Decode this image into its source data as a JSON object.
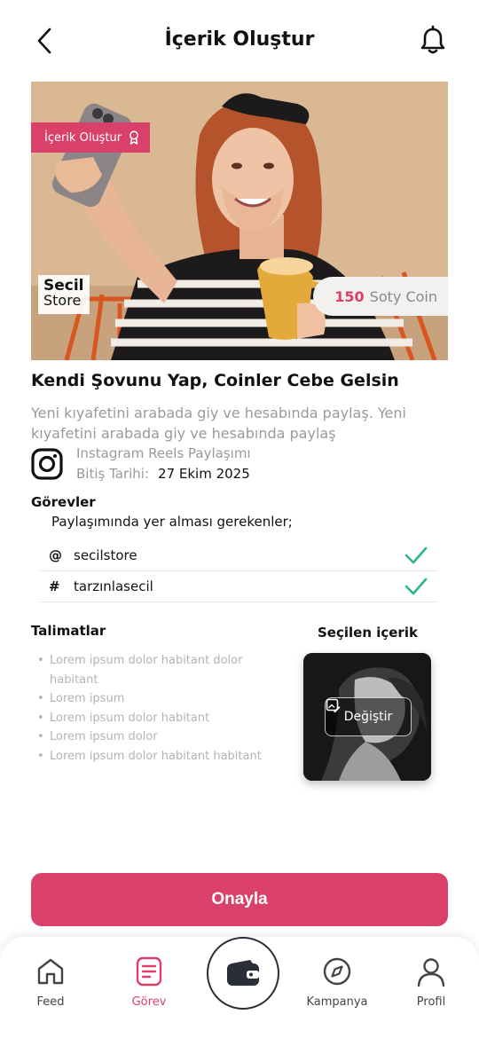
{
  "header": {
    "title": "İçerik Oluştur",
    "back_icon": "chevron-left-icon",
    "notification_icon": "bell-icon"
  },
  "hero": {
    "badge_label": "İçerik Oluştur",
    "badge_icon": "award-icon",
    "brand_line1": "Secil",
    "brand_line2": "Store",
    "coin_amount": "150",
    "coin_label": "Soty Coin"
  },
  "campaign": {
    "title": "Kendi Şovunu Yap, Coinler Cebe Gelsin",
    "description": "Yeni kıyafetini arabada giy ve hesabında paylaş. Yeni kıyafetini arabada giy ve hesabında paylaş",
    "platform_icon": "instagram-icon",
    "content_type": "Instagram Reels Paylaşımı",
    "deadline_label": "Bitiş Tarihi:",
    "deadline_value": "27 Ekim 2025"
  },
  "tasks": {
    "heading": "Görevler",
    "subheading": "Paylaşımında yer alması gerekenler;",
    "items": [
      {
        "symbol": "@",
        "text": "secilstore",
        "done": true
      },
      {
        "symbol": "#",
        "text": "tarzınlasecil",
        "done": true
      }
    ]
  },
  "instructions": {
    "heading": "Talimatlar",
    "items": [
      "Lorem ipsum dolor habitant dolor habitant",
      "Lorem ipsum",
      "Lorem ipsum dolor habitant",
      "Lorem ipsum dolor",
      "Lorem ipsum dolor habitant habitant"
    ]
  },
  "selected": {
    "heading": "Seçilen içerik",
    "change_label": "Değiştir",
    "change_icon": "image-edit-icon"
  },
  "confirm_label": "Onayla",
  "tabbar": {
    "feed": "Feed",
    "tasks": "Görev",
    "campaigns": "Kampanya",
    "profile": "Profil",
    "center_icon": "wallet-icon",
    "active": "Görev"
  },
  "colors": {
    "accent": "#d9416a",
    "check": "#2bb58a",
    "text": "#111111",
    "muted": "#9a9a9a"
  }
}
